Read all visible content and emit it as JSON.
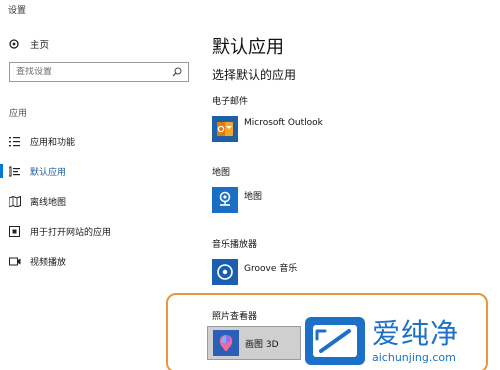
{
  "window": {
    "title": "设置"
  },
  "sidebar": {
    "home_label": "主页",
    "search_placeholder": "查找设置",
    "section_label": "应用",
    "items": [
      {
        "label": "应用和功能",
        "icon": "list-icon",
        "active": false
      },
      {
        "label": "默认应用",
        "icon": "default-apps-icon",
        "active": true
      },
      {
        "label": "离线地图",
        "icon": "map-icon",
        "active": false
      },
      {
        "label": "用于打开网站的应用",
        "icon": "open-web-icon",
        "active": false
      },
      {
        "label": "视频播放",
        "icon": "video-icon",
        "active": false
      }
    ]
  },
  "main": {
    "title": "默认应用",
    "subtitle": "选择默认的应用",
    "categories": [
      {
        "label": "电子邮件",
        "app_name": "Microsoft Outlook",
        "icon": "outlook-icon",
        "color": "#f29a1f"
      },
      {
        "label": "地图",
        "app_name": "地图",
        "icon": "maps-app-icon",
        "color": "#1a6fc4"
      },
      {
        "label": "音乐播放器",
        "app_name": "Groove 音乐",
        "icon": "groove-icon",
        "color": "#1a5fb0"
      },
      {
        "label": "照片查看器",
        "app_name": "画图 3D",
        "icon": "paint3d-icon",
        "color": "#2b5fb8"
      }
    ]
  },
  "watermark": {
    "top_text": "爱纯净",
    "bottom_text": "aichunjing.com",
    "color": "#1c70c8"
  },
  "accent_color": "#0078d7",
  "highlight_color": "#e8983c"
}
